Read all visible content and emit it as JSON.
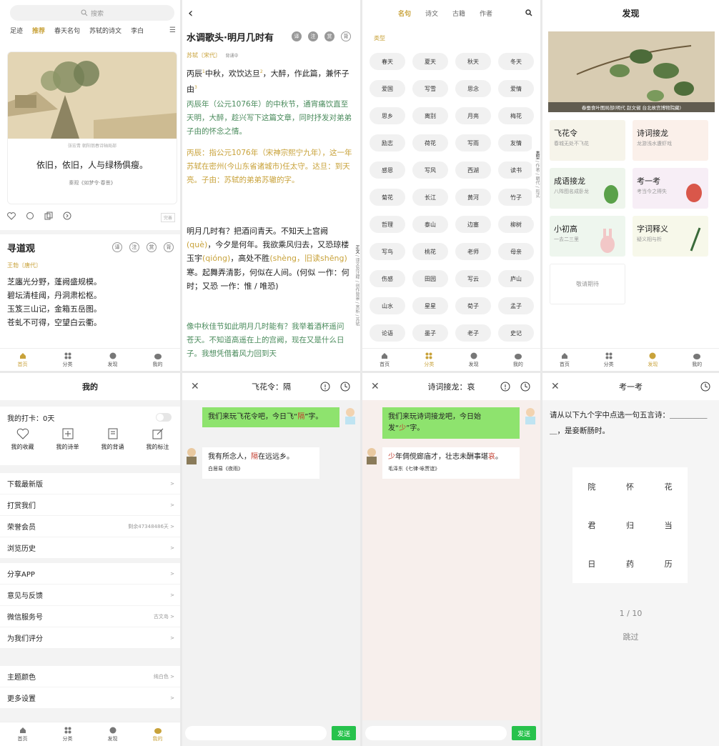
{
  "tabs": {
    "home": "首页",
    "category": "分类",
    "discover": "发现",
    "mine": "我的"
  },
  "p1": {
    "search": "搜索",
    "nav": [
      "足迹",
      "推荐",
      "春天名句",
      "苏轼的诗文",
      "李白"
    ],
    "painting_caption": "张宏青 朝阳翁春诗轴局部",
    "verse": "依旧，依旧，人与绿杨俱瘦。",
    "source": "秦观《如梦令·春景》",
    "badge": "完善",
    "poem_title": "寻道观",
    "poem_author": "王勃〔唐代〕",
    "poem_lines": [
      "芝廛光分野，蓬阙盛规模。",
      "碧坛清桂阈，丹洞肃松枢。",
      "玉笈三山记，金箱五岳图。",
      "苍虬不可得，空望白云衢。"
    ],
    "circle_icons": [
      "译",
      "注",
      "赏",
      "背"
    ]
  },
  "p2": {
    "title": "水调歌头·明月几时有",
    "circles": [
      "译",
      "注",
      "赏",
      "背"
    ],
    "author": "苏轼〔宋代〕",
    "author_tag": "背诵中",
    "side_tabs": [
      "正文",
      "译文及注释",
      "创作背景",
      "赏析",
      "苏轼"
    ],
    "para1_a": "丙辰",
    "para1_b": "中秋，欢饮达旦",
    "para1_c": "，大醉，作此篇，兼怀子由",
    "para1_green": "丙辰年（公元1076年）的中秋节，通宵痛饮直至天明，大醉，趁兴写下这篇文章，同时抒发对弟弟子由的怀念之情。",
    "para1_gold": "丙辰：指公元1076年（宋神宗熙宁九年），这一年苏轼在密州(今山东省诸城市)任太守。达旦：到天亮。子由：苏轼的弟弟苏辙的字。",
    "para2_a": "明月几时有？把酒",
    "para2_b": "问青天。不知天上宫阙",
    "para2_que": "(què)",
    "para2_c": "，今夕是何年。我欲乘风归去",
    "para2_d": "，又恐琼楼玉宇",
    "para2_qiong": "(qióng)",
    "para2_e": "，高处不胜",
    "para2_sheng": "(shèng，旧读shēng)",
    "para2_f": "寒。起舞弄清影",
    "para2_g": "，何似",
    "para2_h": "在人间。(何似 一作：何时；又恐 一作：惟 / 唯恐)",
    "para2_green": "像中秋佳节如此明月几时能有？我举着酒杯遥问苍天。不知道高遥在上的宫阙，现在又是什么日子。我想凭借着风力回到天"
  },
  "p3": {
    "tabs": [
      "名句",
      "诗文",
      "古籍",
      "作者"
    ],
    "label": "类型",
    "side_tabs": [
      "类型",
      "作者",
      "朝代",
      "形式"
    ],
    "chips": [
      "春天",
      "夏天",
      "秋天",
      "冬天",
      "爱国",
      "写雪",
      "思念",
      "爱情",
      "思乡",
      "离别",
      "月亮",
      "梅花",
      "励志",
      "荷花",
      "写雨",
      "友情",
      "感恩",
      "写风",
      "西湖",
      "读书",
      "菊花",
      "长江",
      "黄河",
      "竹子",
      "哲理",
      "泰山",
      "边塞",
      "柳树",
      "写鸟",
      "桃花",
      "老师",
      "母亲",
      "伤感",
      "田园",
      "写云",
      "庐山",
      "山水",
      "星星",
      "荀子",
      "孟子",
      "论语",
      "墨子",
      "老子",
      "史记"
    ]
  },
  "p4": {
    "title": "发现",
    "banner_caption": "春蚕食叶图局部(明代 赵文俶 台北故宫博物院藏)",
    "features": [
      {
        "t": "飞花令",
        "s": "春城无处不飞花"
      },
      {
        "t": "诗词接龙",
        "s": "龙游浅水遭虾戏"
      },
      {
        "t": "成语接龙",
        "s": "八阵图名成卧龙"
      },
      {
        "t": "考一考",
        "s": "考当今之得失"
      },
      {
        "t": "小初高",
        "s": "一去二三里"
      },
      {
        "t": "字词释义",
        "s": "疑义相与析"
      }
    ],
    "coming": "敬请期待"
  },
  "p5": {
    "title": "我的",
    "checkin": "我的打卡：0天",
    "icons": [
      "我的收藏",
      "我的诗单",
      "我的背诵",
      "我的标注"
    ],
    "rows1": [
      {
        "l": "下载最新版",
        "r": ""
      },
      {
        "l": "打赏我们",
        "r": ""
      },
      {
        "l": "荣誉会员",
        "r": "剩余47348486天"
      },
      {
        "l": "浏览历史",
        "r": ""
      }
    ],
    "rows2": [
      {
        "l": "分享APP",
        "r": ""
      },
      {
        "l": "意见与反馈",
        "r": ""
      },
      {
        "l": "微信服务号",
        "r": "古文岛"
      },
      {
        "l": "为我们评分",
        "r": ""
      }
    ],
    "rows3": [
      {
        "l": "主题颜色",
        "r": "纯白色"
      },
      {
        "l": "更多设置",
        "r": ""
      }
    ]
  },
  "p6": {
    "title": "飞花令：隔",
    "me_a": "我们来玩飞花令吧，今日飞“",
    "me_key": "隔",
    "me_b": "”字。",
    "bot_a": "我有所念人，",
    "bot_key": "隔",
    "bot_b": "在远远乡。",
    "bot_src": "白居易《夜雨》",
    "send": "发送"
  },
  "p7": {
    "title": "诗词接龙：哀",
    "me_a": "我们来玩诗词接龙吧，今日始发“",
    "me_key": "少",
    "me_b": "”字。",
    "bot_key1": "少",
    "bot_mid": "年倜傥廊庙才，壮志未酬事堪",
    "bot_key2": "哀",
    "bot_end": "。",
    "bot_src": "毛泽东《七律·咏贾谊》",
    "send": "发送"
  },
  "p8": {
    "title": "考一考",
    "question": "请从以下九个字中点选一句五言诗：＿＿＿＿＿＿，是妾断肠时。",
    "chars": [
      "院",
      "怀",
      "花",
      "君",
      "归",
      "当",
      "日",
      "药",
      "历"
    ],
    "progress": "1 / 10",
    "skip": "跳过"
  }
}
